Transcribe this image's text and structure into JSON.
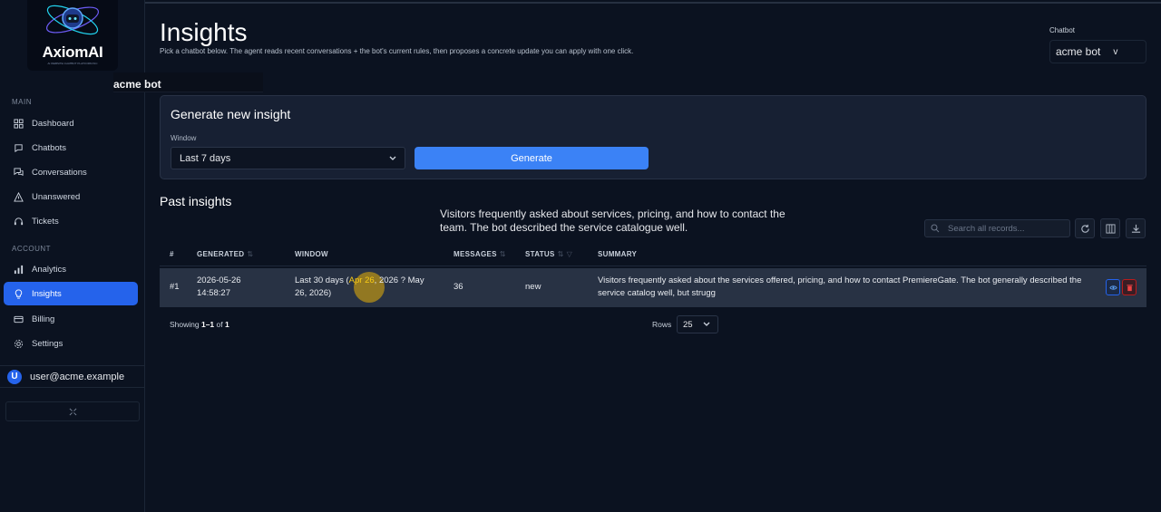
{
  "app": {
    "logo_text": "AxiomAI",
    "logo_subtext": "AI WEBSITE CHATBOT PLATFORM INC"
  },
  "sidebar": {
    "current_bot": "acme bot",
    "main_label": "MAIN",
    "account_label": "ACCOUNT",
    "main_items": [
      {
        "label": "Dashboard",
        "icon": "grid-icon"
      },
      {
        "label": "Chatbots",
        "icon": "chat-bubble-icon"
      },
      {
        "label": "Conversations",
        "icon": "conversations-icon"
      },
      {
        "label": "Unanswered",
        "icon": "warning-icon"
      },
      {
        "label": "Tickets",
        "icon": "headset-icon"
      }
    ],
    "account_items": [
      {
        "label": "Analytics",
        "icon": "bar-chart-icon"
      },
      {
        "label": "Insights",
        "icon": "lightbulb-icon",
        "active": true
      },
      {
        "label": "Billing",
        "icon": "card-icon"
      },
      {
        "label": "Settings",
        "icon": "gear-icon"
      }
    ],
    "user": {
      "initial": "U",
      "email": "user@acme.example"
    },
    "collapse_icon": "collapse-icon"
  },
  "header": {
    "title": "Insights",
    "description": "Pick a chatbot below. The agent reads recent conversations + the bot's current rules, then proposes a concrete update you can apply with one click.",
    "chatbot_label": "Chatbot",
    "chatbot_value": "acme bot",
    "chatbot_chevron": "v"
  },
  "generate": {
    "title": "Generate new insight",
    "window_label": "Window",
    "window_value": "Last 7 days",
    "button_label": "Generate"
  },
  "past": {
    "title": "Past insights",
    "tooltip": "Visitors frequently asked about services, pricing, and how to contact the team. The bot described the service catalogue well.",
    "search_placeholder": "Search all records...",
    "columns": {
      "num": "#",
      "generated": "GENERATED",
      "window": "WINDOW",
      "messages": "MESSAGES",
      "status": "STATUS",
      "summary": "SUMMARY"
    },
    "rows": [
      {
        "num": "#1",
        "generated_date": "2026-05-26",
        "generated_time": "14:58:27",
        "window_a": "Last 30 days (",
        "window_b": "Apr 26",
        "window_c": ", 2026 ? May",
        "window_d": "26, 2026)",
        "messages": "36",
        "status": "new",
        "summary": "Visitors frequently asked about the services offered, pricing, and how to contact PremiereGate. The bot generally described the service catalog well, but strugg"
      }
    ],
    "showing_prefix": "Showing ",
    "showing_range": "1–1",
    "showing_of": " of ",
    "showing_total": "1",
    "rows_label": "Rows",
    "rows_value": "25"
  },
  "colors": {
    "accent": "#3b82f6",
    "active_nav": "#2563eb",
    "highlight": "#facc15",
    "danger": "#b91c1c"
  }
}
